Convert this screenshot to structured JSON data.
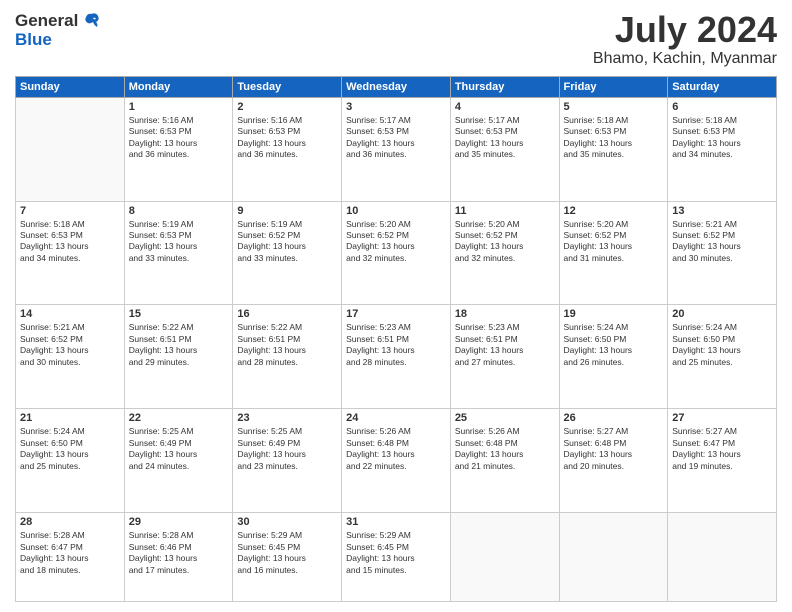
{
  "header": {
    "logo_general": "General",
    "logo_blue": "Blue",
    "month_year": "July 2024",
    "location": "Bhamo, Kachin, Myanmar"
  },
  "weekdays": [
    "Sunday",
    "Monday",
    "Tuesday",
    "Wednesday",
    "Thursday",
    "Friday",
    "Saturday"
  ],
  "weeks": [
    [
      {
        "day": "",
        "info": ""
      },
      {
        "day": "1",
        "info": "Sunrise: 5:16 AM\nSunset: 6:53 PM\nDaylight: 13 hours\nand 36 minutes."
      },
      {
        "day": "2",
        "info": "Sunrise: 5:16 AM\nSunset: 6:53 PM\nDaylight: 13 hours\nand 36 minutes."
      },
      {
        "day": "3",
        "info": "Sunrise: 5:17 AM\nSunset: 6:53 PM\nDaylight: 13 hours\nand 36 minutes."
      },
      {
        "day": "4",
        "info": "Sunrise: 5:17 AM\nSunset: 6:53 PM\nDaylight: 13 hours\nand 35 minutes."
      },
      {
        "day": "5",
        "info": "Sunrise: 5:18 AM\nSunset: 6:53 PM\nDaylight: 13 hours\nand 35 minutes."
      },
      {
        "day": "6",
        "info": "Sunrise: 5:18 AM\nSunset: 6:53 PM\nDaylight: 13 hours\nand 34 minutes."
      }
    ],
    [
      {
        "day": "7",
        "info": "Sunrise: 5:18 AM\nSunset: 6:53 PM\nDaylight: 13 hours\nand 34 minutes."
      },
      {
        "day": "8",
        "info": "Sunrise: 5:19 AM\nSunset: 6:53 PM\nDaylight: 13 hours\nand 33 minutes."
      },
      {
        "day": "9",
        "info": "Sunrise: 5:19 AM\nSunset: 6:52 PM\nDaylight: 13 hours\nand 33 minutes."
      },
      {
        "day": "10",
        "info": "Sunrise: 5:20 AM\nSunset: 6:52 PM\nDaylight: 13 hours\nand 32 minutes."
      },
      {
        "day": "11",
        "info": "Sunrise: 5:20 AM\nSunset: 6:52 PM\nDaylight: 13 hours\nand 32 minutes."
      },
      {
        "day": "12",
        "info": "Sunrise: 5:20 AM\nSunset: 6:52 PM\nDaylight: 13 hours\nand 31 minutes."
      },
      {
        "day": "13",
        "info": "Sunrise: 5:21 AM\nSunset: 6:52 PM\nDaylight: 13 hours\nand 30 minutes."
      }
    ],
    [
      {
        "day": "14",
        "info": "Sunrise: 5:21 AM\nSunset: 6:52 PM\nDaylight: 13 hours\nand 30 minutes."
      },
      {
        "day": "15",
        "info": "Sunrise: 5:22 AM\nSunset: 6:51 PM\nDaylight: 13 hours\nand 29 minutes."
      },
      {
        "day": "16",
        "info": "Sunrise: 5:22 AM\nSunset: 6:51 PM\nDaylight: 13 hours\nand 28 minutes."
      },
      {
        "day": "17",
        "info": "Sunrise: 5:23 AM\nSunset: 6:51 PM\nDaylight: 13 hours\nand 28 minutes."
      },
      {
        "day": "18",
        "info": "Sunrise: 5:23 AM\nSunset: 6:51 PM\nDaylight: 13 hours\nand 27 minutes."
      },
      {
        "day": "19",
        "info": "Sunrise: 5:24 AM\nSunset: 6:50 PM\nDaylight: 13 hours\nand 26 minutes."
      },
      {
        "day": "20",
        "info": "Sunrise: 5:24 AM\nSunset: 6:50 PM\nDaylight: 13 hours\nand 25 minutes."
      }
    ],
    [
      {
        "day": "21",
        "info": "Sunrise: 5:24 AM\nSunset: 6:50 PM\nDaylight: 13 hours\nand 25 minutes."
      },
      {
        "day": "22",
        "info": "Sunrise: 5:25 AM\nSunset: 6:49 PM\nDaylight: 13 hours\nand 24 minutes."
      },
      {
        "day": "23",
        "info": "Sunrise: 5:25 AM\nSunset: 6:49 PM\nDaylight: 13 hours\nand 23 minutes."
      },
      {
        "day": "24",
        "info": "Sunrise: 5:26 AM\nSunset: 6:48 PM\nDaylight: 13 hours\nand 22 minutes."
      },
      {
        "day": "25",
        "info": "Sunrise: 5:26 AM\nSunset: 6:48 PM\nDaylight: 13 hours\nand 21 minutes."
      },
      {
        "day": "26",
        "info": "Sunrise: 5:27 AM\nSunset: 6:48 PM\nDaylight: 13 hours\nand 20 minutes."
      },
      {
        "day": "27",
        "info": "Sunrise: 5:27 AM\nSunset: 6:47 PM\nDaylight: 13 hours\nand 19 minutes."
      }
    ],
    [
      {
        "day": "28",
        "info": "Sunrise: 5:28 AM\nSunset: 6:47 PM\nDaylight: 13 hours\nand 18 minutes."
      },
      {
        "day": "29",
        "info": "Sunrise: 5:28 AM\nSunset: 6:46 PM\nDaylight: 13 hours\nand 17 minutes."
      },
      {
        "day": "30",
        "info": "Sunrise: 5:29 AM\nSunset: 6:45 PM\nDaylight: 13 hours\nand 16 minutes."
      },
      {
        "day": "31",
        "info": "Sunrise: 5:29 AM\nSunset: 6:45 PM\nDaylight: 13 hours\nand 15 minutes."
      },
      {
        "day": "",
        "info": ""
      },
      {
        "day": "",
        "info": ""
      },
      {
        "day": "",
        "info": ""
      }
    ]
  ]
}
